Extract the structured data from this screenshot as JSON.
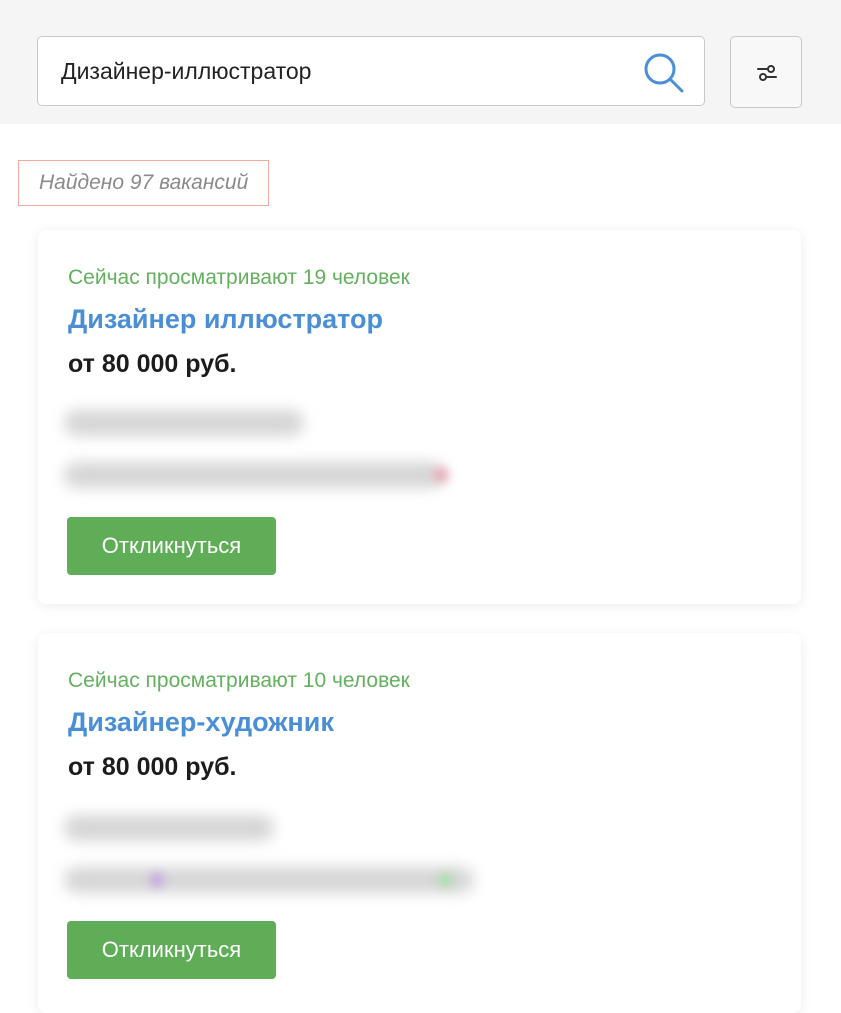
{
  "search": {
    "value": "Дизайнер-иллюстратор",
    "icon": "search-icon",
    "filter_icon": "sliders-icon"
  },
  "results": {
    "count_text": "Найдено 97 вакансий"
  },
  "vacancies": [
    {
      "viewers": "Сейчас просматривают 19 человек",
      "title": "Дизайнер иллюстратор",
      "salary": "от 80 000 руб.",
      "apply_label": "Откликнуться"
    },
    {
      "viewers": "Сейчас просматривают 10 человек",
      "title": "Дизайнер-художник",
      "salary": "от 80 000 руб.",
      "apply_label": "Откликнуться"
    }
  ],
  "colors": {
    "accent_green": "#5fae57",
    "title_blue": "#4a8fd6",
    "highlight_border": "#f3a99b"
  }
}
